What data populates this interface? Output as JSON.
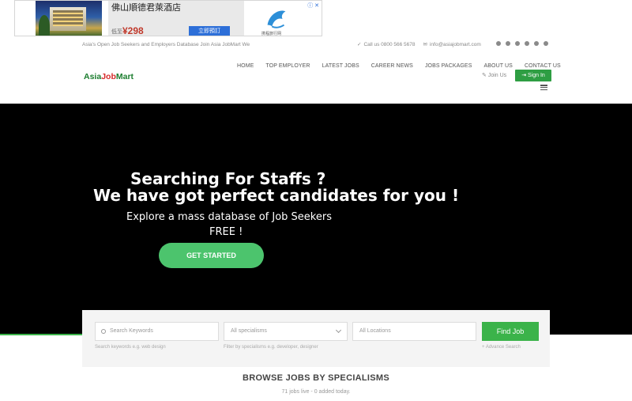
{
  "ad": {
    "title": "佛山順德君萊酒店",
    "price": "¥298",
    "price_prefix": "低至",
    "button": "立即預訂",
    "logo_text": "携程旅行网",
    "close": "ⓘ ✕"
  },
  "topbar": {
    "tagline": "Asia's Open Job Seekers and Employers Database Join Asia JobMart We",
    "phone": "Call us 0800 566 5678",
    "email": "info@asiajobmart.com"
  },
  "logo": {
    "part1": "Asia",
    "part2": "Job",
    "part3": "Mart"
  },
  "nav": {
    "items": [
      "HOME",
      "TOP EMPLOYER",
      "LATEST JOBS",
      "CAREER NEWS",
      "JOBS PACKAGES",
      "ABOUT US",
      "CONTACT US"
    ],
    "join": "Join Us",
    "signin": "Sign In"
  },
  "hero": {
    "line1": "Searching For Staffs ?",
    "line2": "We have got perfect candidates for you !",
    "line3": "Explore a mass database of Job Seekers",
    "line4": "FREE !",
    "cta": "GET STARTED"
  },
  "search": {
    "keywords_placeholder": "Search Keywords",
    "specialisms_placeholder": "All specialisms",
    "locations_placeholder": "All Locations",
    "find_button": "Find Job",
    "keywords_hint": "Search keywords e.g. web design",
    "specialisms_hint": "Filter by specialisms e.g. developer, designer",
    "advance": "+ Advance Search"
  },
  "browse": {
    "title": "BROWSE JOBS BY SPECIALISMS",
    "count": "71 jobs live - 0 added today."
  }
}
